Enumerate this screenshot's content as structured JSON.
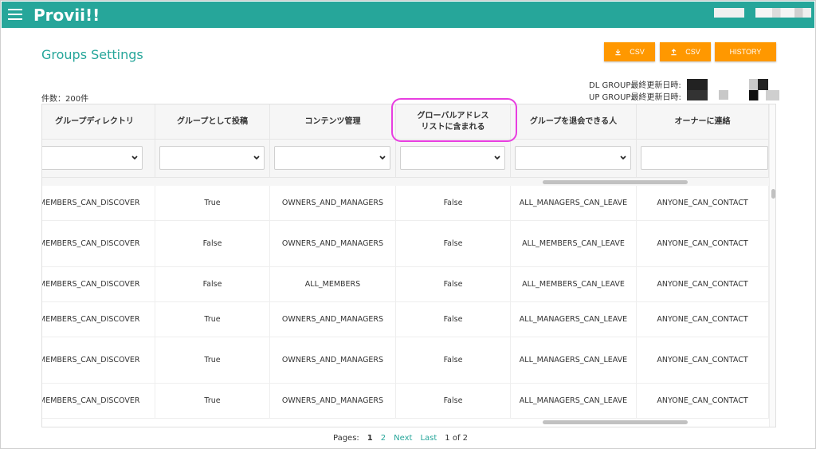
{
  "app": {
    "title": "Provii!!"
  },
  "page": {
    "title": "Groups Settings"
  },
  "toolbar": {
    "download_csv_label": "CSV",
    "upload_csv_label": "CSV",
    "history_label": "HISTORY"
  },
  "summary": {
    "count_text": "件数：200件",
    "dl_group_label": "DL GROUP最終更新日時:",
    "up_group_label": "UP GROUP最終更新日時:"
  },
  "table": {
    "headers": [
      "グループディレクトリ",
      "グループとして投稿",
      "コンテンツ管理",
      "グローバルアドレスリストに含まれる",
      "グループを退会できる人",
      "オーナーに連絡"
    ],
    "rows": [
      [
        "MEMBERS_CAN_DISCOVER",
        "True",
        "OWNERS_AND_MANAGERS",
        "False",
        "ALL_MANAGERS_CAN_LEAVE",
        "ANYONE_CAN_CONTACT"
      ],
      [
        "MEMBERS_CAN_DISCOVER",
        "False",
        "OWNERS_AND_MANAGERS",
        "False",
        "ALL_MEMBERS_CAN_LEAVE",
        "ANYONE_CAN_CONTACT"
      ],
      [
        "MEMBERS_CAN_DISCOVER",
        "False",
        "ALL_MEMBERS",
        "False",
        "ALL_MEMBERS_CAN_LEAVE",
        "ANYONE_CAN_CONTACT"
      ],
      [
        "MEMBERS_CAN_DISCOVER",
        "True",
        "OWNERS_AND_MANAGERS",
        "False",
        "ALL_MANAGERS_CAN_LEAVE",
        "ANYONE_CAN_CONTACT"
      ],
      [
        "MEMBERS_CAN_DISCOVER",
        "True",
        "OWNERS_AND_MANAGERS",
        "False",
        "ALL_MANAGERS_CAN_LEAVE",
        "ANYONE_CAN_CONTACT"
      ],
      [
        "MEMBERS_CAN_DISCOVER",
        "True",
        "OWNERS_AND_MANAGERS",
        "False",
        "ALL_MANAGERS_CAN_LEAVE",
        "ANYONE_CAN_CONTACT"
      ]
    ]
  },
  "pagination": {
    "label": "Pages:",
    "current": "1",
    "page2": "2",
    "next": "Next",
    "last": "Last",
    "status": "1 of 2"
  },
  "colors": {
    "primary": "#26a69a",
    "accent": "#ff9800",
    "highlight": "#e83ee0"
  },
  "icons": {
    "menu": "menu-icon",
    "download": "download-icon",
    "upload": "upload-icon",
    "dropdown": "chevron-down-icon"
  }
}
